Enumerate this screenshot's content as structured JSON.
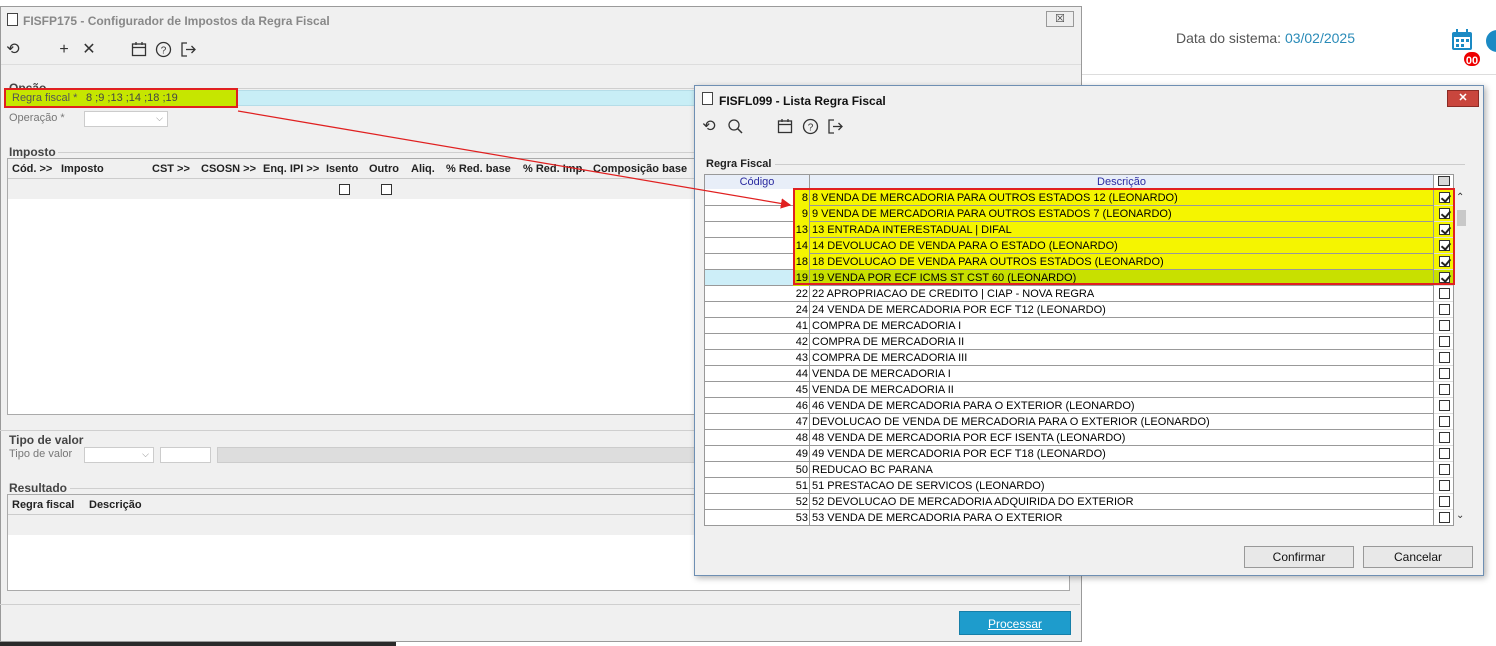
{
  "system": {
    "date_label": "Data do sistema: ",
    "date_value": "03/02/2025",
    "notif_count": "00"
  },
  "main_window": {
    "title": "FISFP175 - Configurador de Impostos da Regra Fiscal",
    "close_label": "☒",
    "toolbar": [
      "refresh-icon",
      "add-icon",
      "delete-icon",
      "calendar-icon",
      "help-icon",
      "exit-icon"
    ],
    "opcao": {
      "section": "Opção",
      "regra_label": "Regra fiscal *",
      "regra_value": "8 ;9 ;13 ;14 ;18 ;19",
      "operacao_label": "Operação *"
    },
    "imposto": {
      "section": "Imposto",
      "columns": [
        "Cód. >>",
        "Imposto",
        "CST >>",
        "CSOSN >>",
        "Enq. IPI >>",
        "Isento",
        "Outro",
        "Aliq.",
        "% Red. base",
        "% Red. Imp.",
        "Composição base"
      ]
    },
    "tipo_valor": {
      "section": "Tipo de valor",
      "label": "Tipo de valor"
    },
    "resultado": {
      "section": "Resultado",
      "columns": [
        "Regra fiscal",
        "Descrição"
      ]
    },
    "processar_label": "Processar"
  },
  "dialog": {
    "title": "FISFL099 - Lista Regra Fiscal",
    "close_label": "✕",
    "toolbar": [
      "refresh-icon",
      "search-icon",
      "calendar-icon",
      "help-icon",
      "exit-icon"
    ],
    "group_label": "Regra Fiscal",
    "col_codigo": "Código",
    "col_descricao": "Descrição",
    "rows": [
      {
        "code": "8",
        "desc": "8 VENDA DE MERCADORIA PARA OUTROS ESTADOS 12 (LEONARDO)",
        "checked": true
      },
      {
        "code": "9",
        "desc": "9 VENDA DE MERCADORIA PARA OUTROS ESTADOS 7 (LEONARDO)",
        "checked": true
      },
      {
        "code": "13",
        "desc": "13 ENTRADA INTERESTADUAL | DIFAL",
        "checked": true
      },
      {
        "code": "14",
        "desc": "14 DEVOLUCAO DE VENDA PARA O ESTADO (LEONARDO)",
        "checked": true
      },
      {
        "code": "18",
        "desc": "18 DEVOLUCAO DE VENDA PARA OUTROS ESTADOS (LEONARDO)",
        "checked": true
      },
      {
        "code": "19",
        "desc": "19 VENDA POR ECF ICMS ST CST 60 (LEONARDO)",
        "checked": true
      },
      {
        "code": "22",
        "desc": "22 APROPRIACAO DE CREDITO | CIAP - NOVA REGRA",
        "checked": false
      },
      {
        "code": "24",
        "desc": "24 VENDA DE MERCADORIA POR ECF T12 (LEONARDO)",
        "checked": false
      },
      {
        "code": "41",
        "desc": "COMPRA DE MERCADORIA I",
        "checked": false
      },
      {
        "code": "42",
        "desc": "COMPRA DE MERCADORIA II",
        "checked": false
      },
      {
        "code": "43",
        "desc": "COMPRA DE MERCADORIA III",
        "checked": false
      },
      {
        "code": "44",
        "desc": "VENDA DE MERCADORIA I",
        "checked": false
      },
      {
        "code": "45",
        "desc": "VENDA DE MERCADORIA II",
        "checked": false
      },
      {
        "code": "46",
        "desc": "46 VENDA DE MERCADORIA PARA O EXTERIOR (LEONARDO)",
        "checked": false
      },
      {
        "code": "47",
        "desc": "DEVOLUCAO DE VENDA DE MERCADORIA PARA O EXTERIOR (LEONARDO)",
        "checked": false
      },
      {
        "code": "48",
        "desc": "48 VENDA DE MERCADORIA POR ECF ISENTA (LEONARDO)",
        "checked": false
      },
      {
        "code": "49",
        "desc": "49 VENDA DE MERCADORIA POR ECF T18 (LEONARDO)",
        "checked": false
      },
      {
        "code": "50",
        "desc": "REDUCAO BC PARANA",
        "checked": false
      },
      {
        "code": "51",
        "desc": "51 PRESTACAO DE SERVICOS (LEONARDO)",
        "checked": false
      },
      {
        "code": "52",
        "desc": "52 DEVOLUCAO DE MERCADORIA ADQUIRIDA DO EXTERIOR",
        "checked": false
      },
      {
        "code": "53",
        "desc": "53 VENDA DE MERCADORIA PARA O EXTERIOR",
        "checked": false
      }
    ],
    "confirmar_label": "Confirmar",
    "cancelar_label": "Cancelar"
  }
}
